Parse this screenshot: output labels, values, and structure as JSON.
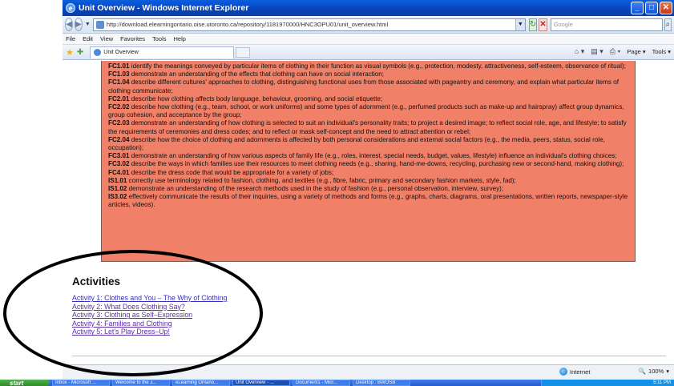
{
  "window": {
    "title": "Unit Overview - Windows Internet Explorer",
    "min": "_",
    "max": "□",
    "close": "✕"
  },
  "address": {
    "back": "◀",
    "forward": "▶",
    "url": "http://download.elearningontario.oise.utoronto.ca/repository/1181970000/HNC3OPU01/unit_overview.html",
    "search_placeholder": "Google",
    "refresh": "↻",
    "stop": "✕",
    "go": "⌕"
  },
  "menu": [
    "File",
    "Edit",
    "View",
    "Favorites",
    "Tools",
    "Help"
  ],
  "tab": {
    "label": "Unit Overview"
  },
  "commandbar": {
    "page": "Page ▾",
    "tools": "Tools ▾"
  },
  "expectations": [
    {
      "code": "FC1.01",
      "text": " identify the meanings conveyed by particular items of clothing in their function as visual symbols (e.g., protection, modesty, attractiveness, self-esteem, observance of ritual);"
    },
    {
      "code": "FC1.03",
      "text": " demonstrate an understanding of the effects that clothing can have on social interaction;"
    },
    {
      "code": "FC1.04",
      "text": " describe different cultures' approaches to clothing, distinguishing functional uses from those associated with pageantry and ceremony, and explain what particular items of clothing communicate;"
    },
    {
      "code": "FC2.01",
      "text": " describe how clothing affects body language, behaviour, grooming, and social etiquette;"
    },
    {
      "code": "FC2.02",
      "text": " describe how clothing (e.g., team, school, or work uniforms) and some types of adornment (e.g., perfumed products such as make-up and hairspray) affect group dynamics, group cohesion, and acceptance by the group;"
    },
    {
      "code": "FC2.03",
      "text": " demonstrate an understanding of how clothing is selected to suit an individual's personality traits; to project a desired image; to reflect social role, age, and lifestyle; to satisfy the requirements of ceremonies and dress codes; and to reflect or mask self-concept and the need to attract attention or rebel;"
    },
    {
      "code": "FC2.04",
      "text": " describe how the choice of clothing and adornments is affected by both personal considerations and external social factors (e.g., the media, peers, status, social role, occupation);"
    },
    {
      "code": "FC3.01",
      "text": " demonstrate an understanding of how various aspects of family life (e.g., roles, interest, special needs, budget, values, lifestyle) influence an individual's clothing choices;"
    },
    {
      "code": "FC3.02",
      "text": " describe the ways in which families use their resources to meet clothing needs (e.g., sharing, hand-me-downs, recycling, purchasing new or second-hand, making clothing);"
    },
    {
      "code": "FC4.01",
      "text": " describe the dress code that would be appropriate for a variety of jobs;"
    },
    {
      "code": "IS1.01",
      "text": " correctly use terminology related to fashion, clothing, and textiles (e.g., fibre, fabric, primary and secondary fashion markets, style, fad);"
    },
    {
      "code": "IS1.02",
      "text": " demonstrate an understanding of the research methods used in the study of fashion (e.g., personal observation, interview, survey);"
    },
    {
      "code": "IS3.02",
      "text": " effectively communicate the results of their inquiries, using a variety of methods and forms (e.g., graphs, charts, diagrams, oral presentations, written reports, newspaper-style articles, videos)."
    }
  ],
  "activities": {
    "heading": "Activities",
    "links": [
      "Activity 1: Clothes and You – The Why of Clothing",
      "Activity 2: What Does Clothing Say?",
      "Activity 3: Clothing as Self–Expression",
      "Activity 4: Families and Clothing",
      "Activity 5: Let's Play Dress–Up!"
    ]
  },
  "status": {
    "zone": "Internet",
    "zoom": "100%"
  },
  "taskbar": {
    "start": "start",
    "items": [
      "Inbox - Microsoft ...",
      "Welcome to the J...",
      "eLearning Ontario...",
      "Unit Overview - ...",
      "Document1 - Micr...",
      "Desktop : BWOSB"
    ],
    "clock": "5:11 PM"
  },
  "colors": {
    "accent_box": "#f08068",
    "link": "#5b2ea8"
  }
}
